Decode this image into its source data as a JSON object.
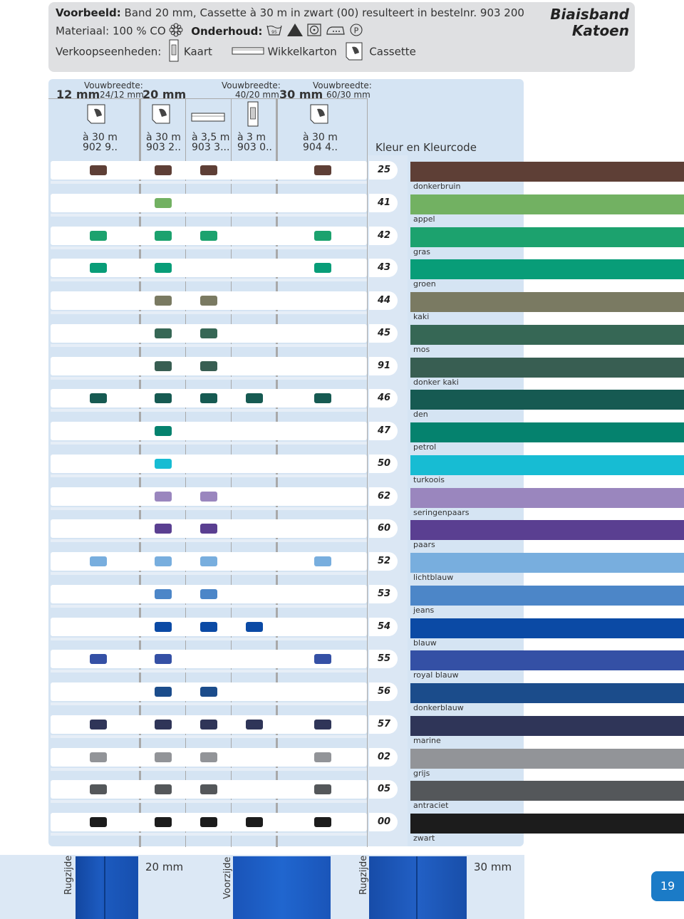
{
  "header": {
    "example_label": "Voorbeeld:",
    "example_text": "Band 20 mm, Cassette à 30 m in zwart (00) resulteert in bestelnr. 903 200",
    "material_label": "Materiaal:",
    "material_value": "100 % CO",
    "care_label": "Onderhoud:",
    "wash_temp": "95",
    "iron_mark": "P",
    "sales_label": "Verkoopseenheden:",
    "sales_units": [
      "Kaart",
      "Wikkelkarton",
      "Cassette"
    ],
    "brand_line1": "Biaisband",
    "brand_line2": "Katoen"
  },
  "columns": {
    "width_label": "Vouwbreedte:",
    "groups": [
      {
        "mm": "12 mm",
        "fold": "24/12 mm"
      },
      {
        "mm": "20 mm",
        "fold": "40/20 mm"
      },
      {
        "mm": "30 mm",
        "fold": "60/30 mm"
      }
    ],
    "items": [
      {
        "qty": "à 30 m",
        "code": "902 9.."
      },
      {
        "qty": "à 30 m",
        "code": "903 2.."
      },
      {
        "qty": "à 3,5 m",
        "code": "903 3..."
      },
      {
        "qty": "à 3 m",
        "code": "903 0.."
      },
      {
        "qty": "à 30 m",
        "code": "904 4.."
      }
    ],
    "color_heading": "Kleur en Kleurcode"
  },
  "colors": [
    {
      "code": "25",
      "name": "donkerbruin",
      "hex": "#5e3f36",
      "avail": [
        1,
        1,
        1,
        0,
        1
      ]
    },
    {
      "code": "41",
      "name": "appel",
      "hex": "#72b162",
      "avail": [
        0,
        1,
        0,
        0,
        0
      ]
    },
    {
      "code": "42",
      "name": "gras",
      "hex": "#1ca26e",
      "avail": [
        1,
        1,
        1,
        0,
        1
      ]
    },
    {
      "code": "43",
      "name": "groen",
      "hex": "#089d78",
      "avail": [
        1,
        1,
        0,
        0,
        1
      ]
    },
    {
      "code": "44",
      "name": "kaki",
      "hex": "#7a7a62",
      "avail": [
        0,
        1,
        1,
        0,
        0
      ]
    },
    {
      "code": "45",
      "name": "mos",
      "hex": "#366755",
      "avail": [
        0,
        1,
        1,
        0,
        0
      ]
    },
    {
      "code": "91",
      "name": "donker kaki",
      "hex": "#385e52",
      "avail": [
        0,
        1,
        1,
        0,
        0
      ]
    },
    {
      "code": "46",
      "name": "den",
      "hex": "#165a52",
      "avail": [
        1,
        1,
        1,
        1,
        1
      ]
    },
    {
      "code": "47",
      "name": "petrol",
      "hex": "#05826e",
      "avail": [
        0,
        1,
        0,
        0,
        0
      ]
    },
    {
      "code": "50",
      "name": "turkoois",
      "hex": "#17bcd3",
      "avail": [
        0,
        1,
        0,
        0,
        0
      ]
    },
    {
      "code": "62",
      "name": "seringenpaars",
      "hex": "#9a86be",
      "avail": [
        0,
        1,
        1,
        0,
        0
      ]
    },
    {
      "code": "60",
      "name": "paars",
      "hex": "#5a3f91",
      "avail": [
        0,
        1,
        1,
        0,
        0
      ]
    },
    {
      "code": "52",
      "name": "lichtblauw",
      "hex": "#78aede",
      "avail": [
        1,
        1,
        1,
        0,
        1
      ]
    },
    {
      "code": "53",
      "name": "jeans",
      "hex": "#4c86c8",
      "avail": [
        0,
        1,
        1,
        0,
        0
      ]
    },
    {
      "code": "54",
      "name": "blauw",
      "hex": "#0b4aa5",
      "avail": [
        0,
        1,
        1,
        1,
        0
      ]
    },
    {
      "code": "55",
      "name": "royal blauw",
      "hex": "#3450a5",
      "avail": [
        1,
        1,
        0,
        0,
        1
      ]
    },
    {
      "code": "56",
      "name": "donkerblauw",
      "hex": "#1b4c8b",
      "avail": [
        0,
        1,
        1,
        0,
        0
      ]
    },
    {
      "code": "57",
      "name": "marine",
      "hex": "#2f3558",
      "avail": [
        1,
        1,
        1,
        1,
        1
      ]
    },
    {
      "code": "02",
      "name": "grijs",
      "hex": "#929498",
      "avail": [
        1,
        1,
        1,
        0,
        1
      ]
    },
    {
      "code": "05",
      "name": "antraciet",
      "hex": "#54575a",
      "avail": [
        1,
        1,
        1,
        0,
        1
      ]
    },
    {
      "code": "00",
      "name": "zwart",
      "hex": "#1c1c1c",
      "avail": [
        1,
        1,
        1,
        1,
        1
      ]
    }
  ],
  "footer": {
    "back_label": "Rugzijde",
    "front_label": "Voorzijde",
    "size_20": "20 mm",
    "size_30": "30 mm",
    "page_number": "19"
  }
}
